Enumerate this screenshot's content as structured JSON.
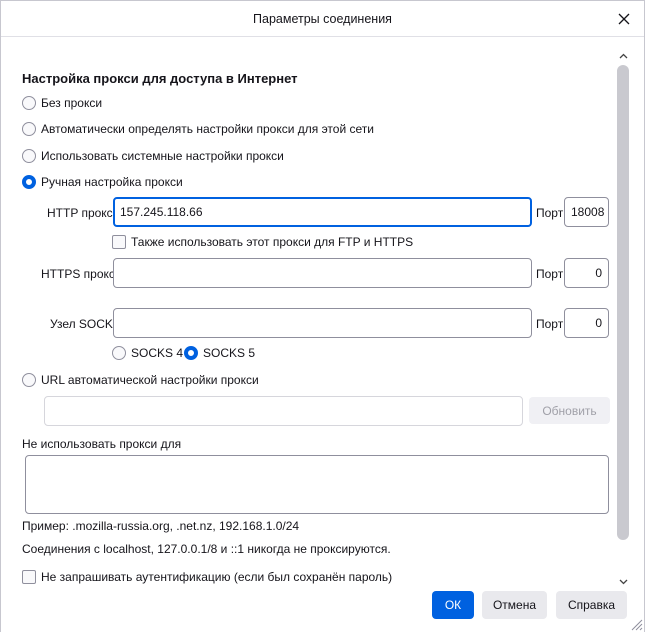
{
  "window": {
    "title": "Параметры соединения"
  },
  "proxy": {
    "heading": "Настройка прокси для доступа в Интернет",
    "options": [
      {
        "label": "Без прокси",
        "checked": false
      },
      {
        "label": "Автоматически определять настройки прокси для этой сети",
        "checked": false
      },
      {
        "label": "Использовать системные настройки прокси",
        "checked": false
      },
      {
        "label": "Ручная настройка прокси",
        "checked": true
      }
    ],
    "http_label": "HTTP прокси",
    "http_value": "157.245.118.66",
    "http_port_label": "Порт",
    "http_port_value": "18008",
    "also_use_label": "Также использовать этот прокси для FTP и HTTPS",
    "https_label": "HTTPS прокси",
    "https_value": "",
    "https_port_label": "Порт",
    "https_port_value": "0",
    "socks_label": "Узел SOCKS",
    "socks_value": "",
    "socks_port_label": "Порт",
    "socks_port_value": "0",
    "socks4_label": "SOCKS 4",
    "socks5_label": "SOCKS 5",
    "socks_version_selected": "SOCKS 5",
    "auto_url_label": "URL автоматической настройки прокси",
    "auto_url_value": "",
    "reload_label": "Обновить",
    "no_proxy_label": "Не использовать прокси для",
    "no_proxy_value": "",
    "example_text": "Пример: .mozilla-russia.org, .net.nz, 192.168.1.0/24",
    "localhost_text": "Соединения с localhost, 127.0.0.1/8 и ::1 никогда не проксируются.",
    "no_auth_label": "Не запрашивать аутентификацию (если был сохранён пароль)"
  },
  "footer": {
    "ok": "ОК",
    "cancel": "Отмена",
    "help": "Справка"
  },
  "colors": {
    "accent": "#0061e0",
    "button": "#e9e9ed",
    "border": "#8f8f9d"
  },
  "icons": [
    "close-icon",
    "scroll-up-icon",
    "scroll-down-icon",
    "resize-grip-icon"
  ]
}
